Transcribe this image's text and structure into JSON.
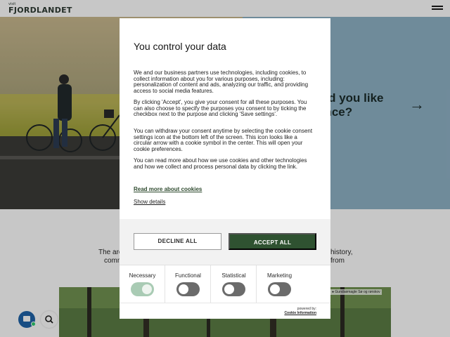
{
  "site": {
    "logo_small": "visit",
    "logo_main": "FJORDLANDET",
    "hero_heading": "…uld you like …ience?",
    "hero_heading_line1": "uld you like",
    "hero_heading_line2": "ence?",
    "hero_arrow": "→",
    "body_left_line1": "The are",
    "body_left_line2": "comm",
    "body_right_line1": "history,",
    "body_right_line2": "from",
    "location_label": "Gundsømagle Sø og rørskov"
  },
  "consent": {
    "title": "You control your data",
    "paragraphs": [
      "We and our business partners use technologies, including cookies, to collect information about you for various purposes, including: personalization of content and ads, analyzing our traffic, and providing access to social media features.",
      "By clicking 'Accept', you give your consent for all these purposes. You can also choose to specify the purposes you consent to by ticking the checkbox next to the purpose and clicking 'Save settings'.",
      "You can withdraw your consent anytime by selecting the cookie consent settings icon at the bottom left of the screen. This icon looks like a circular arrow with a cookie symbol in the center. This will open your cookie preferences.",
      "You can read more about how we use cookies and other technologies and how we collect and process personal data by clicking the link."
    ],
    "read_more_label": "Read more about cookies",
    "show_details_label": "Show details",
    "decline_label": "DECLINE ALL",
    "accept_label": "ACCEPT ALL",
    "categories": [
      {
        "label": "Necessary",
        "enabled": true
      },
      {
        "label": "Functional",
        "enabled": false
      },
      {
        "label": "Statistical",
        "enabled": false
      },
      {
        "label": "Marketing",
        "enabled": false
      }
    ],
    "powered_by": "powered by:",
    "powered_name": "Cookie Information"
  },
  "icons": {
    "chat": "chat-icon",
    "search": "search-icon",
    "menu": "hamburger-menu-icon",
    "location": "location-pin-icon"
  },
  "colors": {
    "accept_button": "#2f5231",
    "switch_off": "#6b6b6b",
    "switch_on": "#a9cbb4",
    "chat_button": "#1f63a8"
  }
}
